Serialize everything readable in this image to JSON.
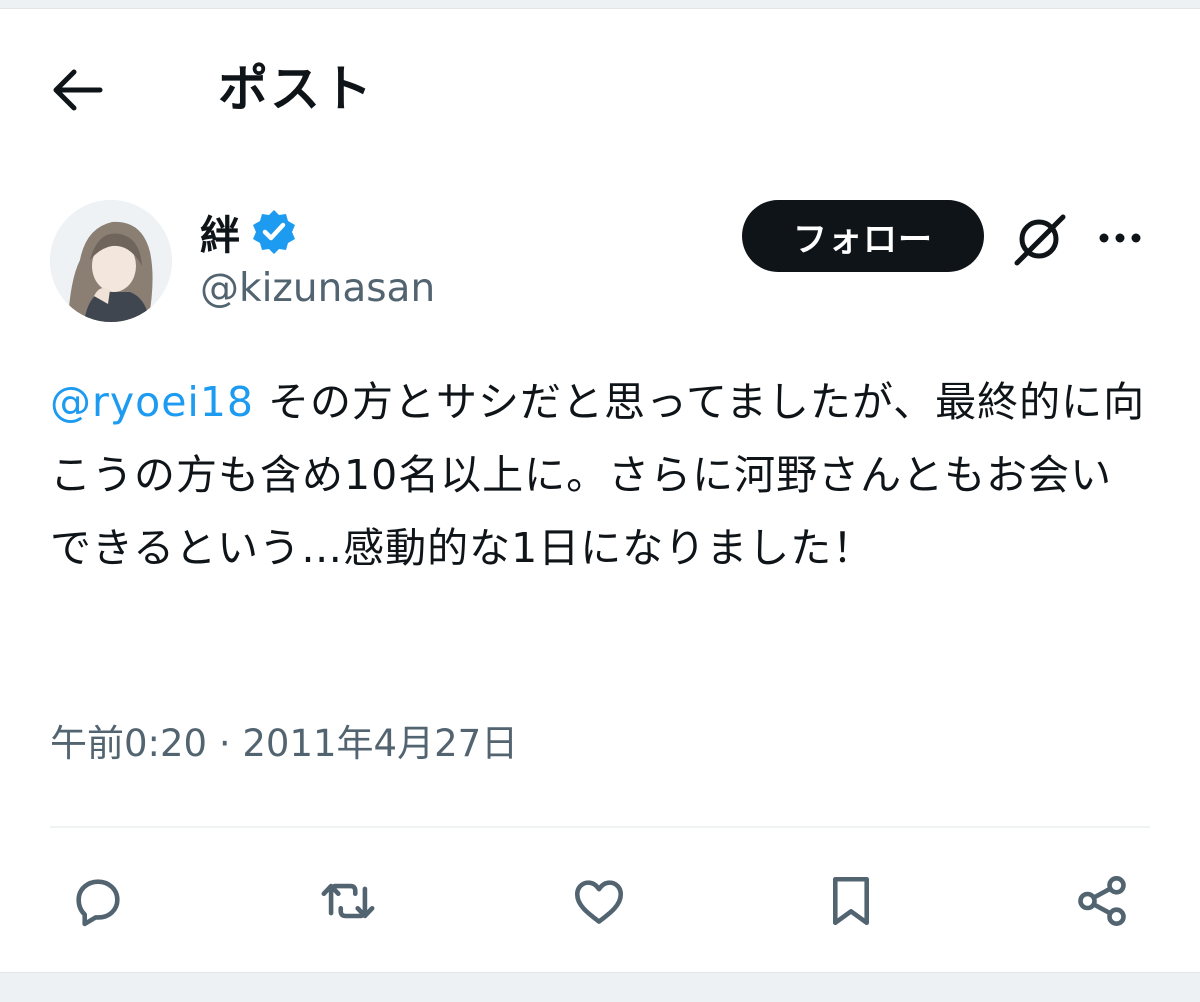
{
  "header": {
    "title": "ポスト"
  },
  "author": {
    "display_name": "絆",
    "handle": "@kizunasan",
    "verified": true
  },
  "follow_label": "フォロー",
  "post": {
    "mention": "@ryoei18",
    "body": " その方とサシだと思ってましたが、最終的に向こうの方も含め10名以上に。さらに河野さんともお会いできるという…感動的な1日になりました！"
  },
  "meta": {
    "time": "午前0:20",
    "separator": "·",
    "date": "2011年4月27日"
  },
  "icons": {
    "back": "back-arrow-icon",
    "verified": "verified-badge-icon",
    "grok": "grok-icon",
    "more": "more-icon",
    "reply": "reply-icon",
    "repost": "repost-icon",
    "like": "heart-icon",
    "bookmark": "bookmark-icon",
    "share": "share-icon"
  },
  "colors": {
    "accent": "#1d9bf0",
    "text": "#0f1419",
    "secondary": "#536471",
    "button": "#0f1419"
  }
}
